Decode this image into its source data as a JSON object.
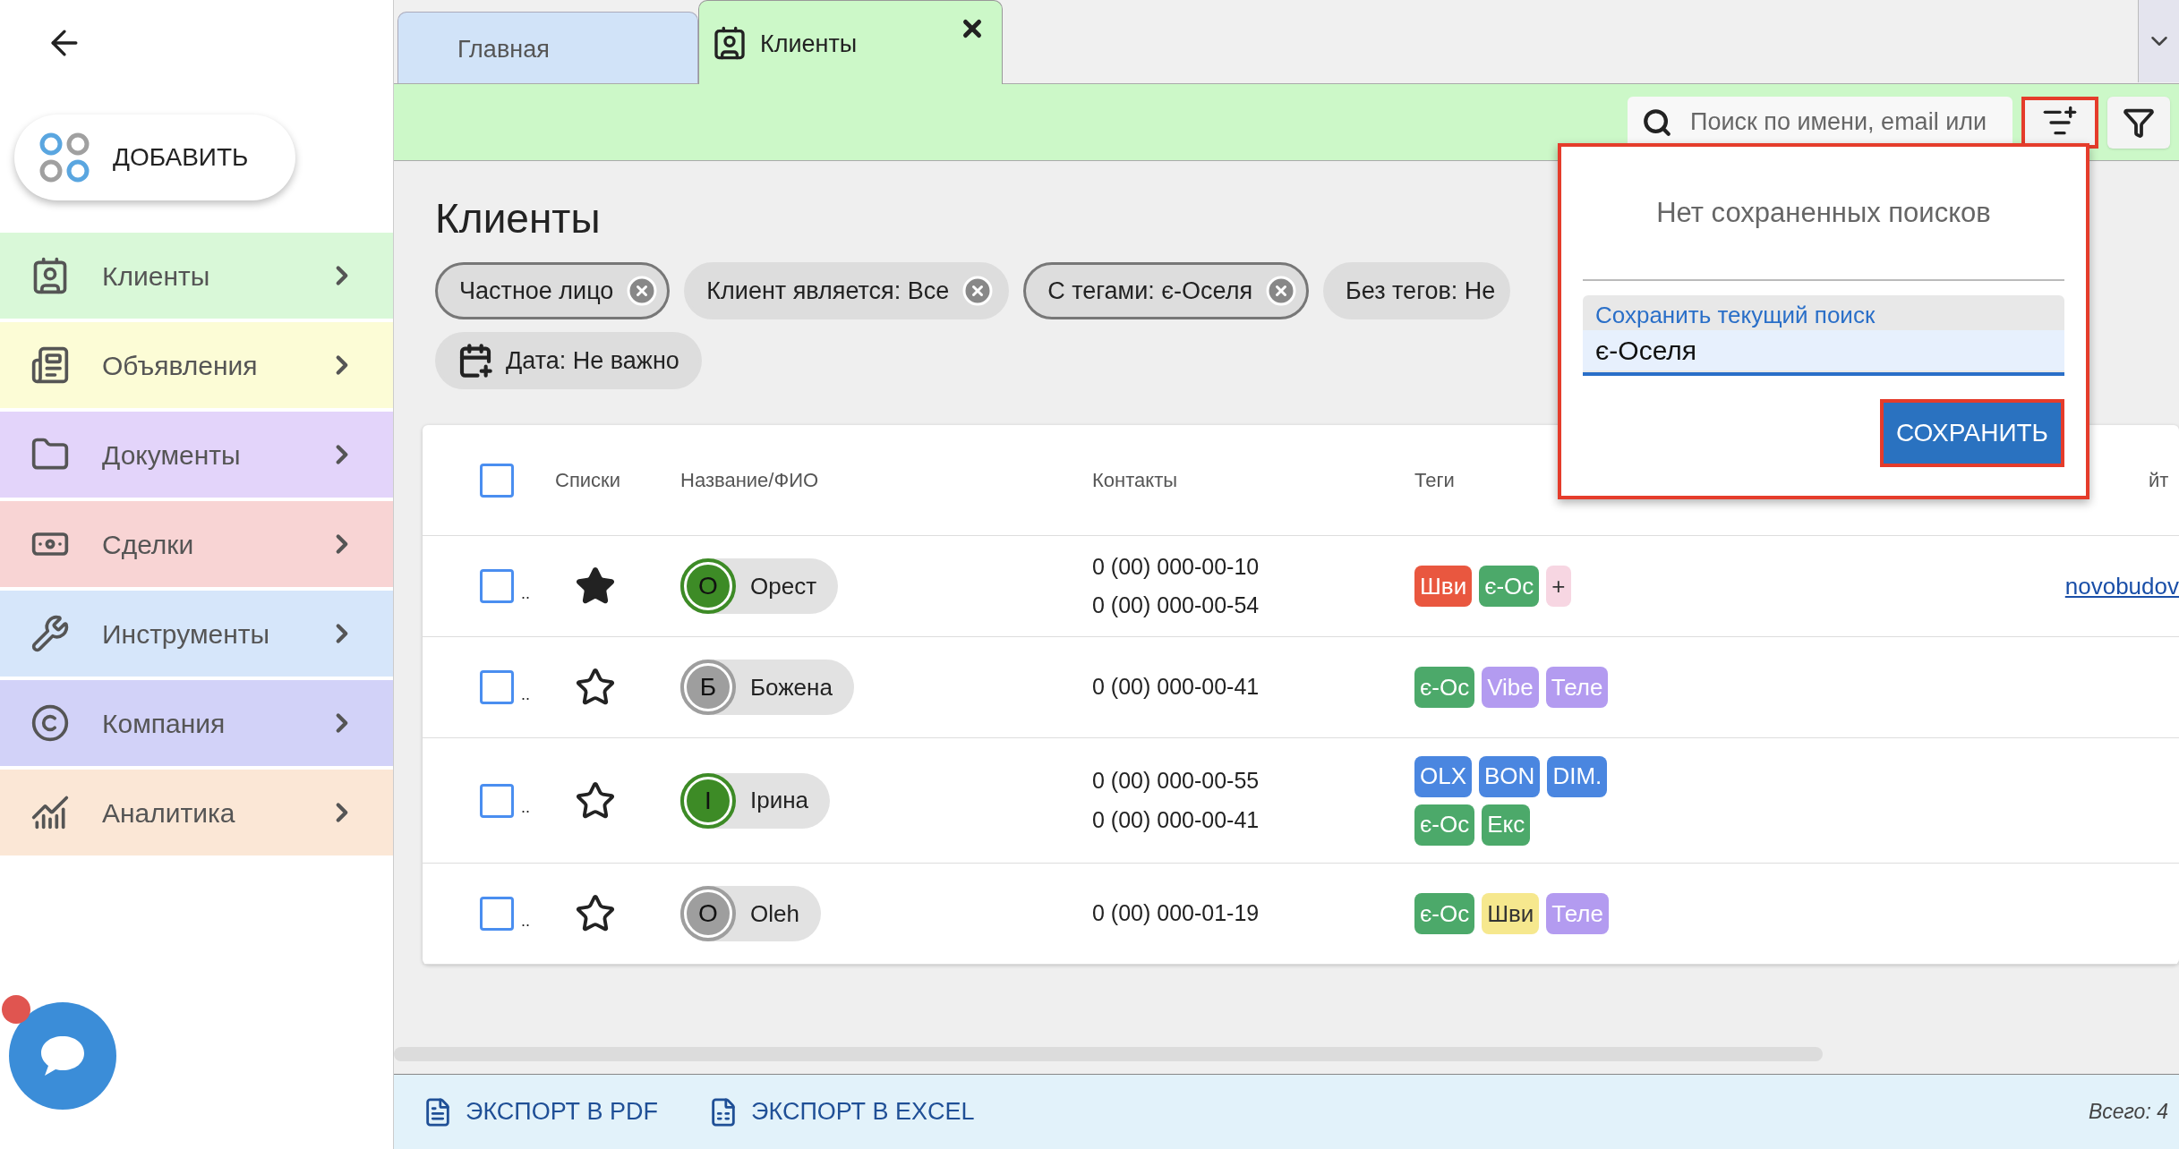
{
  "sidebar": {
    "add_button": "ДОБАВИТЬ",
    "items": [
      {
        "label": "Клиенты",
        "kind": "clients",
        "color": "#d9f8d8"
      },
      {
        "label": "Объявления",
        "kind": "ads",
        "color": "#fcfcd6"
      },
      {
        "label": "Документы",
        "kind": "folder",
        "color": "#e3d4fa"
      },
      {
        "label": "Сделки",
        "kind": "money",
        "color": "#f8d4d4"
      },
      {
        "label": "Инструменты",
        "kind": "tools",
        "color": "#d6e6fa"
      },
      {
        "label": "Компания",
        "kind": "company",
        "color": "#d2d2f8"
      },
      {
        "label": "Аналитика",
        "kind": "analytics",
        "color": "#fbe7d6"
      }
    ]
  },
  "tabs": [
    {
      "label": "Главная",
      "selected": false
    },
    {
      "label": "Клиенты",
      "selected": true
    }
  ],
  "search": {
    "placeholder": "Поиск по имени, email или"
  },
  "page_title": "Клиенты",
  "filters": [
    {
      "label": "Частное лицо",
      "kind": "removable",
      "outlined": true
    },
    {
      "label": "Клиент является: Все",
      "kind": "removable",
      "outlined": false
    },
    {
      "label": "С тегами: є-Оселя",
      "kind": "removable",
      "outlined": true
    },
    {
      "label": "Без тегов: Не",
      "kind": "plain",
      "outlined": false
    },
    {
      "label": "Дата: Не важно",
      "kind": "date",
      "outlined": false
    }
  ],
  "saved_search_popup": {
    "empty_text": "Нет сохраненных поисков",
    "field_label": "Сохранить текущий поиск",
    "field_value": "є-Оселя",
    "button": "СОХРАНИТЬ"
  },
  "table": {
    "select_all_checked": false,
    "columns": [
      "Списки",
      "Название/ФИО",
      "Контакты",
      "Теги",
      "йт"
    ],
    "rows": [
      {
        "checked": false,
        "marker": "..",
        "starred": true,
        "initial": "О",
        "name": "Орест",
        "color": "#3d8b26",
        "phones": [
          "0 (00) 000-00-10",
          "0 (00) 000-00-54"
        ],
        "tags": [
          {
            "label": "Шви",
            "color": "#e9573f"
          },
          {
            "label": "є-Ос",
            "color": "#4ca96a"
          },
          {
            "label": "+",
            "color": "#f7d6e2"
          }
        ],
        "link": "novobudov"
      },
      {
        "checked": false,
        "marker": "..",
        "starred": false,
        "initial": "Б",
        "name": "Божена",
        "color": "#9e9e9e",
        "phones": [
          "0 (00) 000-00-41"
        ],
        "tags": [
          {
            "label": "є-Ос",
            "color": "#4ca96a"
          },
          {
            "label": "Vibe",
            "color": "#b39bf0"
          },
          {
            "label": "Теле",
            "color": "#b39bf0"
          }
        ]
      },
      {
        "checked": false,
        "marker": "..",
        "starred": false,
        "initial": "І",
        "name": "Ірина",
        "color": "#3d8b26",
        "phones": [
          "0 (00) 000-00-55",
          "0 (00) 000-00-41"
        ],
        "tags": [
          {
            "label": "OLX",
            "color": "#4a86e0"
          },
          {
            "label": "BON",
            "color": "#4a86e0"
          },
          {
            "label": "DIM.",
            "color": "#4a86e0"
          },
          {
            "label": "є-Ос",
            "color": "#4ca96a"
          },
          {
            "label": "Екс",
            "color": "#4ca96a"
          }
        ]
      },
      {
        "checked": false,
        "marker": "..",
        "starred": false,
        "initial": "О",
        "name": "Oleh",
        "color": "#9e9e9e",
        "phones": [
          "0 (00) 000-01-19"
        ],
        "tags": [
          {
            "label": "є-Ос",
            "color": "#4ca96a"
          },
          {
            "label": "Шви",
            "color": "#f6e88e"
          },
          {
            "label": "Теле",
            "color": "#b39bf0"
          }
        ]
      }
    ]
  },
  "footer": {
    "exports": [
      "ЭКСПОРТ В PDF",
      "ЭКСПОРТ В EXCEL"
    ],
    "total": "Всего: 4"
  }
}
